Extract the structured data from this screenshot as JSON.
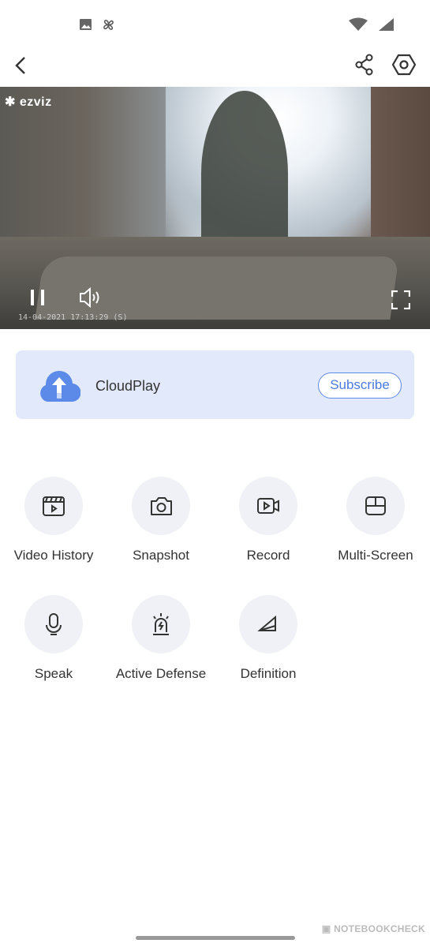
{
  "status_bar": {
    "icons": [
      "image-icon",
      "fan-icon",
      "wifi-icon",
      "signal-icon"
    ]
  },
  "top_bar": {
    "back": "back-icon",
    "share": "share-icon",
    "settings": "settings-icon"
  },
  "video": {
    "brand_logo": "ezviz",
    "timestamp": "14-04-2021 17:13:29  (S)",
    "controls": [
      "pause-icon",
      "volume-icon",
      "fullscreen-icon"
    ]
  },
  "cloud": {
    "title": "CloudPlay",
    "button": "Subscribe",
    "accent": "#5b8ae8",
    "background": "#e1e9fb"
  },
  "features": [
    {
      "label": "Video History",
      "icon": "video-history-icon"
    },
    {
      "label": "Snapshot",
      "icon": "camera-icon"
    },
    {
      "label": "Record",
      "icon": "record-icon"
    },
    {
      "label": "Multi-Screen",
      "icon": "multi-screen-icon"
    },
    {
      "label": "Speak",
      "icon": "microphone-icon"
    },
    {
      "label": "Active Defense",
      "icon": "alarm-icon"
    },
    {
      "label": "Definition",
      "icon": "definition-icon"
    }
  ],
  "watermark": "NOTEBOOKCHECK"
}
